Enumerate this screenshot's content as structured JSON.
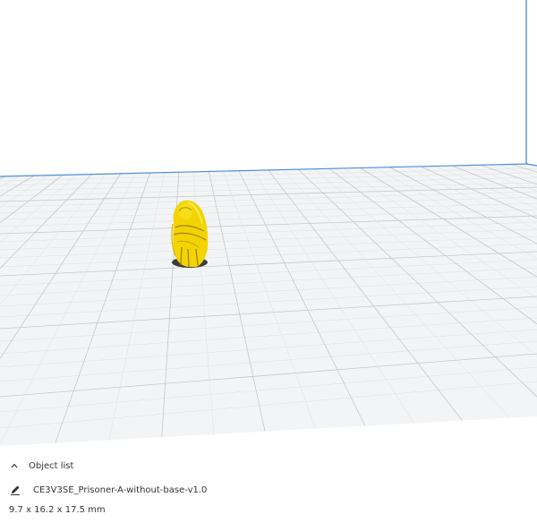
{
  "object_panel": {
    "header_label": "Object list",
    "object_name": "CE3V3SE_Prisoner-A-without-base-v1.0",
    "dimensions": "9.7 x 16.2 x 17.5 mm"
  },
  "colors": {
    "background": "#ffffff",
    "build_plate": "#f3f3f3",
    "grid_line": "#c9ccd0",
    "volume_edge": "#4a90d9",
    "model": "#f5d800",
    "model_shadow": "#444444"
  },
  "icons": {
    "collapse": "chevron-up-icon",
    "edit": "pencil-icon"
  }
}
